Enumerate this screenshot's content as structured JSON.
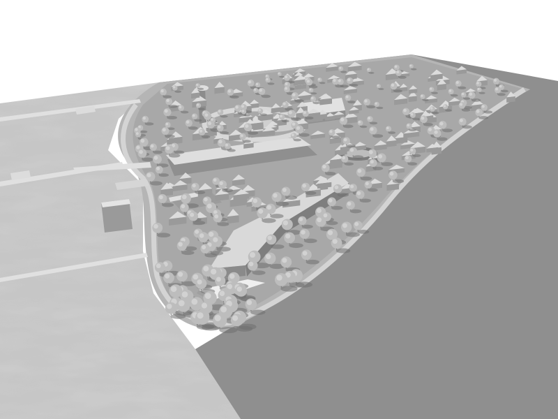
{
  "scene": {
    "subject": "",
    "palette": {
      "sky": "#ffffff",
      "terrain": "#c4c4c4",
      "sea": "#8e8e8e",
      "shore": "#b2b2b2",
      "road": "#d6d6d6",
      "building": "#dcdcdc",
      "building_shade": "#9a9a9a",
      "tree": "#bdbdbd",
      "tree_shade": "#8a8a8a",
      "shadow": "#6f6f6f"
    }
  }
}
